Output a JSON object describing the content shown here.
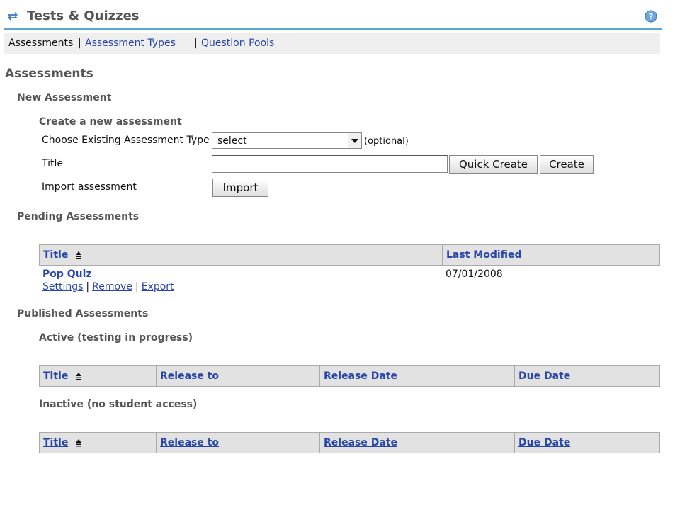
{
  "header": {
    "title": "Tests & Quizzes",
    "refresh_icon": "refresh-icon",
    "help_icon": "help-icon"
  },
  "nav": {
    "current": "Assessments",
    "sep1": "|",
    "link1": "Assessment Types",
    "sep2": "|",
    "link2": "Question Pools"
  },
  "page_title": "Assessments",
  "new_assessment": {
    "heading": "New Assessment",
    "subheading": "Create a new assessment",
    "type_label": "Choose Existing Assessment Type",
    "type_value": "select",
    "optional_text": "(optional)",
    "title_label": "Title",
    "title_value": "",
    "quick_create_label": "Quick Create",
    "create_label": "Create",
    "import_label_text": "Import assessment",
    "import_button": "Import"
  },
  "pending": {
    "heading": "Pending Assessments",
    "columns": [
      "Title",
      "Last Modified"
    ],
    "rows": [
      {
        "title": "Pop Quiz",
        "last_modified": "07/01/2008",
        "actions": [
          "Settings",
          "Remove",
          "Export"
        ]
      }
    ]
  },
  "published": {
    "heading": "Published Assessments",
    "active_heading": "Active (testing in progress)",
    "inactive_heading": "Inactive (no student access)",
    "columns": [
      "Title",
      "Release to",
      "Release Date",
      "Due Date"
    ]
  },
  "colors": {
    "link": "#2746a8",
    "header_rule": "#5aa6d6",
    "heading_gray": "#555555",
    "table_header_bg": "#e2e2e2"
  }
}
